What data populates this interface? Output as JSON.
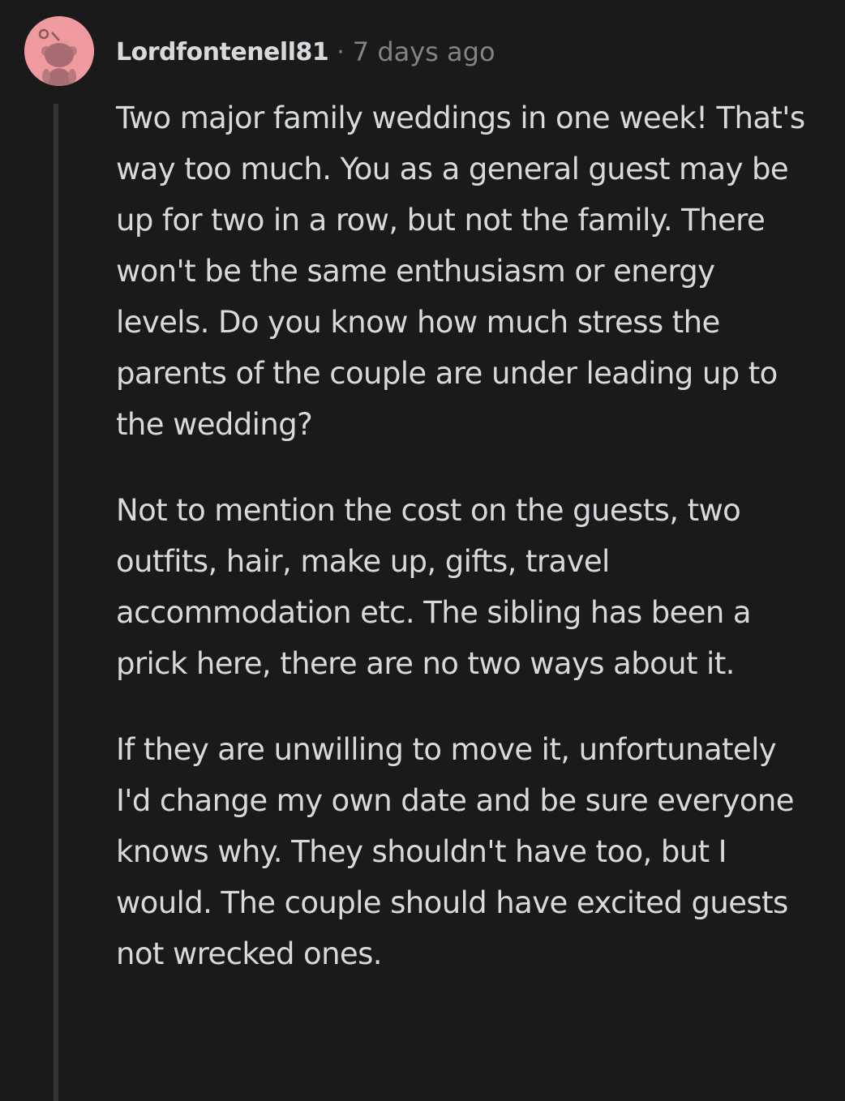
{
  "comment": {
    "username": "Lordfontenell81",
    "separator": "·",
    "timestamp": "7 days ago",
    "paragraphs": [
      "Two major family weddings in one week! That's way too much. You as a general guest may be up for two in a row, but not the family. There won't be the same enthusiasm or energy levels. Do you know how much stress the parents of the couple are under leading up to the wedding?",
      "Not to mention the cost on the guests, two outfits, hair, make up, gifts, travel accommodation etc. The sibling has been a prick here, there are no two ways about it.",
      "If they are unwilling to move it, unfortunately I'd change my own date and be sure everyone knows why. They shouldn't have too, but I would. The couple should have excited guests not wrecked ones."
    ]
  },
  "colors": {
    "background": "#1a1a1b",
    "text": "#d7dadc",
    "muted": "#818384",
    "thread_line": "#343536",
    "avatar_bg": "#ee9a9f"
  },
  "icons": {
    "avatar": "snoo-avatar-icon"
  }
}
